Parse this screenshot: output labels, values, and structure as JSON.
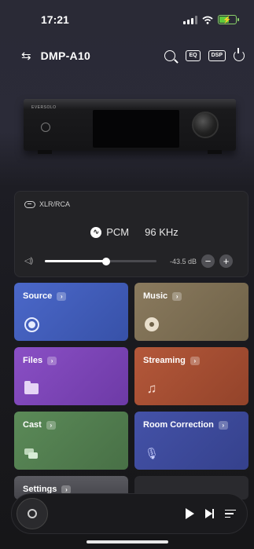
{
  "status_bar": {
    "time": "17:21"
  },
  "header": {
    "device_name": "DMP-A10",
    "eq_label": "EQ",
    "dsp_label": "DSP"
  },
  "device": {
    "brand_mark": "EVERSOLO"
  },
  "player": {
    "output": "XLR/RCA",
    "format": "PCM",
    "sample_rate": "96 KHz",
    "volume_db": "-43.5 dB",
    "volume_level": 0.55
  },
  "tiles": {
    "source": "Source",
    "music": "Music",
    "files": "Files",
    "streaming": "Streaming",
    "cast": "Cast",
    "room_correction": "Room Correction",
    "settings": "Settings"
  },
  "colors": {
    "source": "#4b68c9",
    "music": "#8a7a5e",
    "files": "#8a4fc5",
    "streaming": "#b4583a",
    "cast": "#5b8a58",
    "room_correction": "#4452a8"
  }
}
